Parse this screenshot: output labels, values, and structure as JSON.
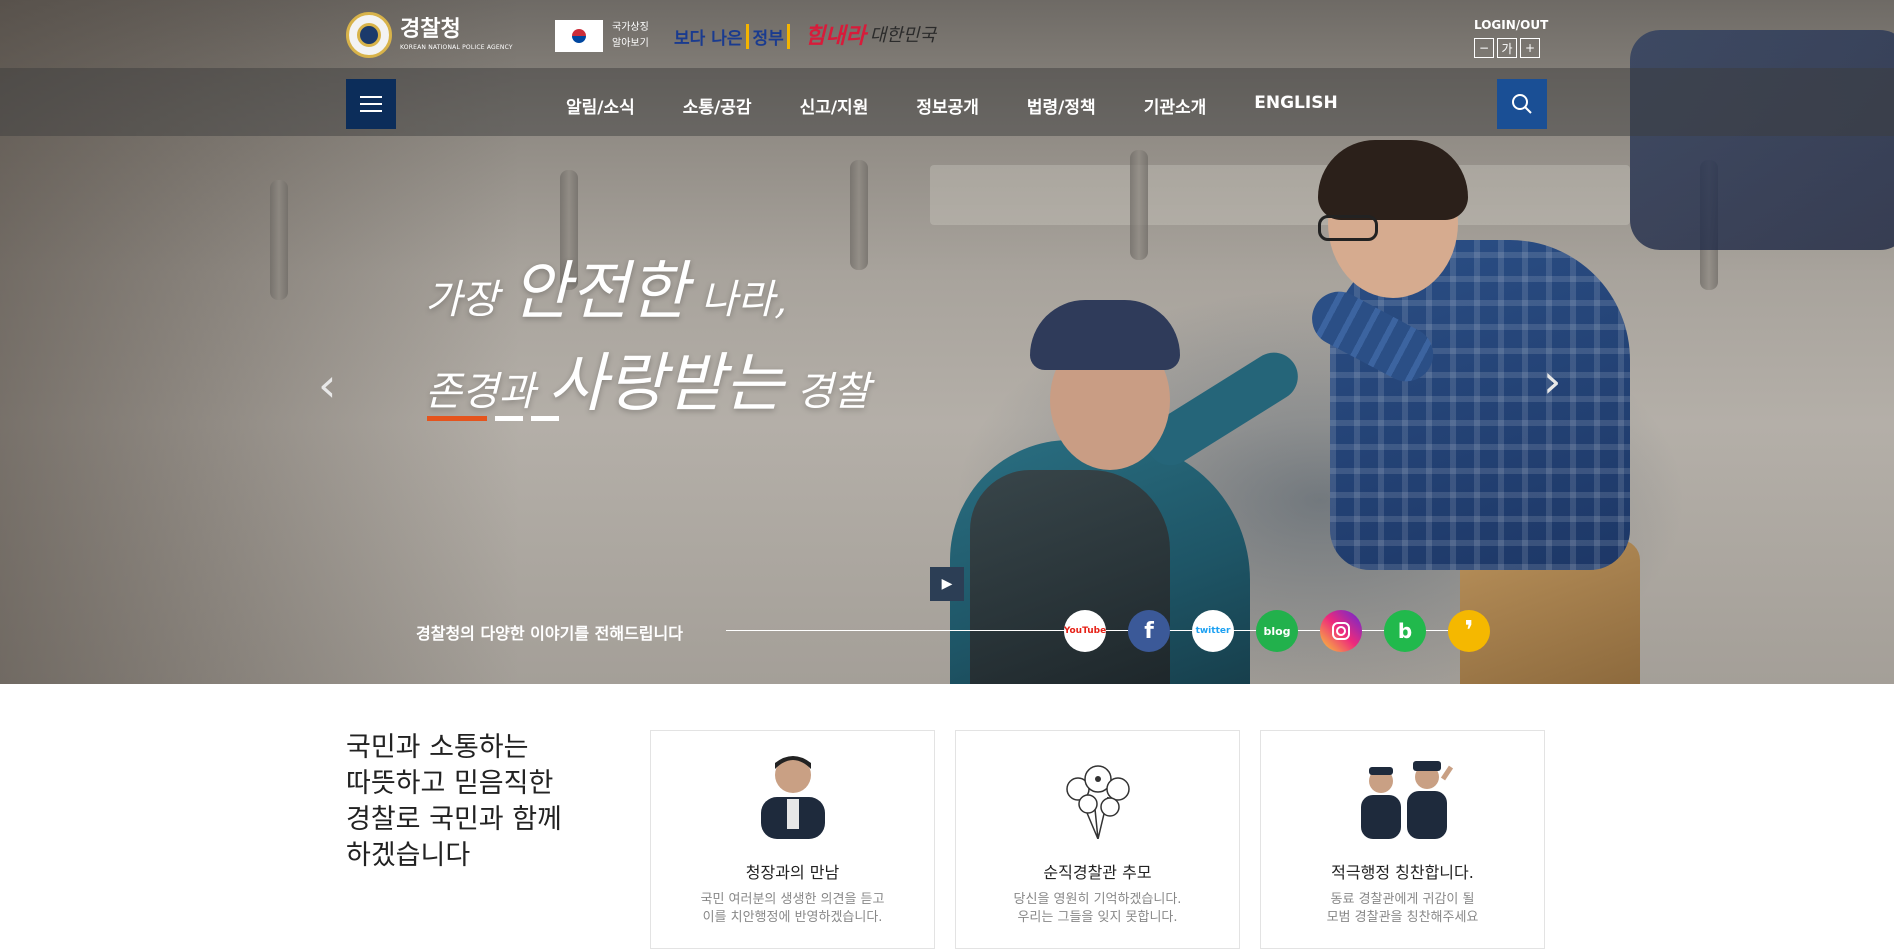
{
  "header": {
    "logo_title": "경찰청",
    "logo_subtitle": "KOREAN NATIONAL POLICE AGENCY",
    "symbol_line1": "국가상징",
    "symbol_line2": "알아보기",
    "gov_logo_a": "보다 나은",
    "gov_logo_b": "정부",
    "cheer_logo_a": "힘내라",
    "cheer_logo_b": "대한민국",
    "login": "LOGIN/OUT",
    "font_minus": "−",
    "font_label": "가",
    "font_plus": "+"
  },
  "nav": {
    "items": [
      {
        "label": "알림/소식"
      },
      {
        "label": "소통/공감"
      },
      {
        "label": "신고/지원"
      },
      {
        "label": "정보공개"
      },
      {
        "label": "법령/정책"
      },
      {
        "label": "기관소개"
      },
      {
        "label": "ENGLISH"
      }
    ]
  },
  "hero": {
    "line1_a": "가장 ",
    "line1_b": "안전한",
    "line1_c": " 나라,",
    "line2_a": "존경과 ",
    "line2_b": "사랑받는",
    "line2_c": " 경찰",
    "slides_total": 3,
    "slide_active": 1,
    "sns_caption": "경찰청의 다양한 이야기를 전해드립니다",
    "sns": [
      {
        "name": "youtube",
        "label": "YouTube",
        "color": "#ffffff"
      },
      {
        "name": "facebook",
        "label": "f",
        "color": "#3b5998"
      },
      {
        "name": "twitter",
        "label": "twitter",
        "color": "#ffffff"
      },
      {
        "name": "blog",
        "label": "blog",
        "color": "#22b14c"
      },
      {
        "name": "instagram",
        "label": "",
        "color": "#c13584"
      },
      {
        "name": "band",
        "label": "b",
        "color": "#21b94c"
      },
      {
        "name": "kakao-story",
        "label": "",
        "color": "#f5b800"
      }
    ]
  },
  "intro": {
    "line1": "국민과 소통하는",
    "line2": "따뜻하고 믿음직한",
    "line3": "경찰로 국민과 함께",
    "line4": "하겠습니다"
  },
  "cards": [
    {
      "title": "청장과의 만남",
      "desc1": "국민 여러분의 생생한 의견을 듣고",
      "desc2": "이를 치안행정에 반영하겠습니다."
    },
    {
      "title": "순직경찰관 추모",
      "desc1": "당신을 영원히 기억하겠습니다.",
      "desc2": "우리는 그들을 잊지 못합니다."
    },
    {
      "title": "적극행정 칭찬합니다.",
      "desc1": "동료 경찰관에게 귀감이 될",
      "desc2": "모범 경찰관을 칭찬해주세요"
    }
  ]
}
